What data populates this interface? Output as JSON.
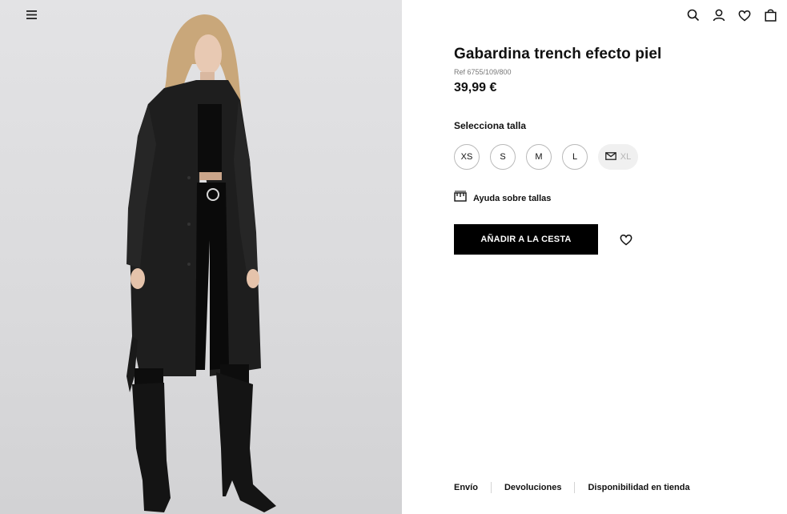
{
  "product": {
    "title": "Gabardina trench efecto piel",
    "ref": "Ref 6755/109/800",
    "price": "39,99 €"
  },
  "sizes": {
    "label": "Selecciona talla",
    "options": [
      "XS",
      "S",
      "M",
      "L"
    ],
    "unavailable": "XL"
  },
  "size_help": "Ayuda sobre tallas",
  "add_to_cart": "AÑADIR A LA CESTA",
  "footer_links": [
    "Envío",
    "Devoluciones",
    "Disponibilidad en tienda"
  ],
  "icons": {
    "menu": "hamburger-menu-icon",
    "header": [
      "search-icon",
      "user-icon",
      "heart-icon",
      "shopping-bag-icon"
    ],
    "size_help": "ruler-icon",
    "notify": "mail-icon",
    "wishlist": "heart-icon"
  },
  "colors": {
    "button_bg": "#000000",
    "photo_bg": "#dcdcde",
    "unavailable_size_bg": "#f0f0f0"
  }
}
